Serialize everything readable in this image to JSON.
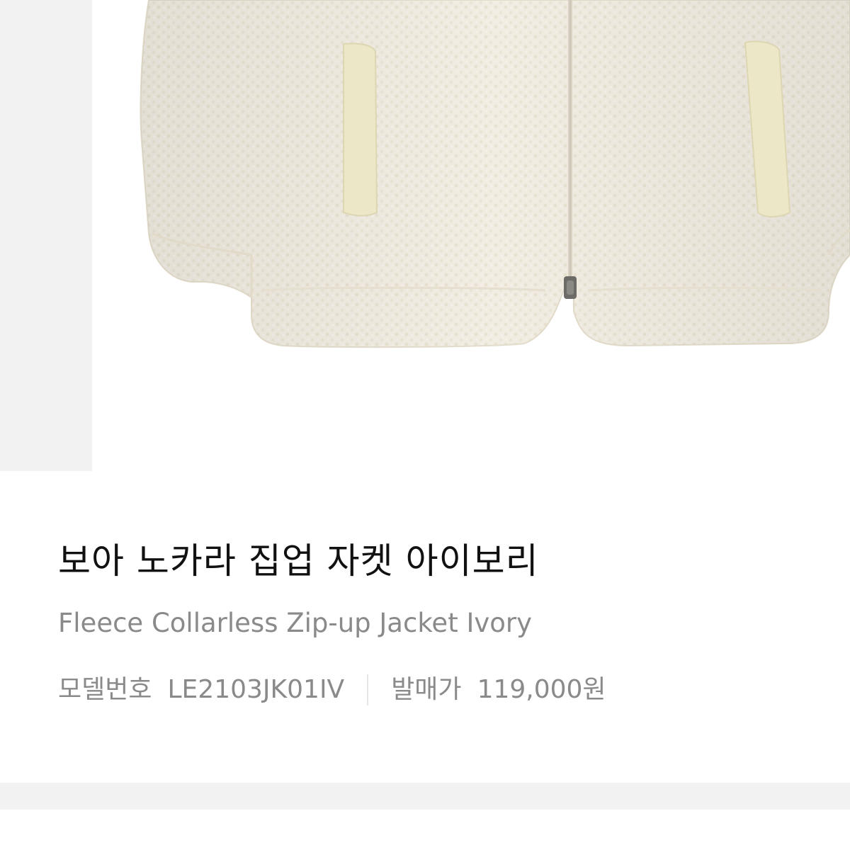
{
  "product": {
    "name_ko": "보아 노카라 집업 자켓 아이보리",
    "name_en": "Fleece Collarless Zip-up Jacket Ivory",
    "model_label": "모델번호",
    "model_number": "LE2103JK01IV",
    "release_price_label": "발매가",
    "release_price": "119,000원"
  },
  "image": {
    "subject": "ivory fleece zip-up jacket",
    "background_color": "#ffffff",
    "fabric_color": "#f1ece0",
    "pocket_trim_color": "#ece7c7"
  },
  "colors": {
    "title": "#111111",
    "secondary_text": "#8a8a8a",
    "divider": "#e6e6e6",
    "panel": "#f2f2f2"
  }
}
